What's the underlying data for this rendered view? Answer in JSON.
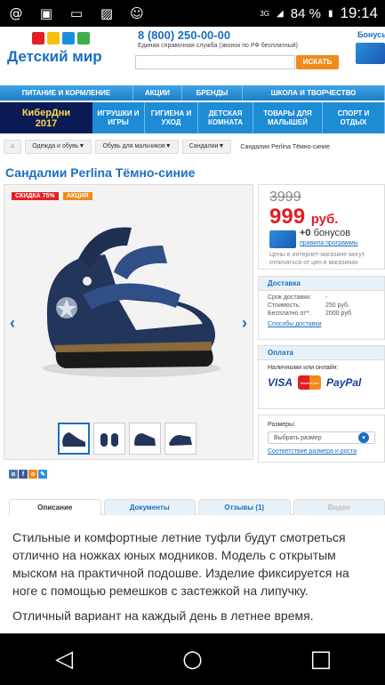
{
  "status_bar": {
    "network": "3G",
    "battery": "84 %",
    "time": "19:14"
  },
  "header": {
    "logo_text": "Детский мир",
    "phone": "8 (800) 250-00-00",
    "phone_sub": "Единая справочная служба (звонок по РФ бесплатный)",
    "search_placeholder": "",
    "search_button": "ИСКАТЬ",
    "bonus_label": "Бонусы"
  },
  "nav_top": [
    "ПИТАНИЕ И КОРМЛЕНИЕ",
    "АКЦИИ",
    "БРЕНДЫ",
    "ШКОЛА И ТВОРЧЕСТВО"
  ],
  "nav_main": {
    "promo_line1": "КиберДни",
    "promo_line2": "2017",
    "items": [
      "ИГРУШКИ И ИГРЫ",
      "ГИГИЕНА И УХОД",
      "ДЕТСКАЯ КОМНАТА",
      "ТОВАРЫ ДЛЯ МАЛЫШЕЙ",
      "СПОРТ И ОТДЫХ"
    ]
  },
  "breadcrumb": [
    "Одежда и обувь▼",
    "Обувь для мальчиков▼",
    "Сандалии▼",
    "Сандалии Perlina Тёмно-синие"
  ],
  "product": {
    "title": "Сандалии Perlina Тёмно-синие",
    "badge_sale": "СКИДКА  75%",
    "badge_promo": "АКЦИЯ",
    "old_price": "3999",
    "new_price": "999",
    "currency": "руб.",
    "bonus": "+0",
    "bonus_word": "бонусов",
    "bonus_rules": "правила программы",
    "price_note": "Цены в интернет-магазине могут отличаться от цен в магазинах"
  },
  "delivery": {
    "header": "Доставка",
    "rows": [
      {
        "k": "Срок доставки:",
        "v": "-"
      },
      {
        "k": "Стоимость:",
        "v": "250 руб."
      },
      {
        "k": "Бесплатно от*:",
        "v": "2000 руб."
      }
    ],
    "link": "Способы доставки"
  },
  "payment": {
    "header": "Оплата",
    "sub": "Наличными или онлайн:",
    "visa": "VISA",
    "mc": "MasterCard",
    "paypal": "PayPal"
  },
  "sizes": {
    "label": "Размеры:",
    "select": "Выбрать размер",
    "link": "Соответствие размера и роста"
  },
  "tabs": [
    "Описание",
    "Документы",
    "Отзывы (1)",
    "Видео"
  ],
  "description": [
    "Стильные и комфортные летние туфли будут смотреться отлично на ножках юных модников. Модель с открытым мыском на практичной подошве. Изделие фиксируется на ноге с помощью ремешков с застежкой на липучку.",
    "Отличный вариант на каждый день в летнее время."
  ],
  "colors": {
    "brand_blue": "#1a6fc0",
    "sale_red": "#e31e24",
    "accent_orange": "#f08a1c"
  }
}
